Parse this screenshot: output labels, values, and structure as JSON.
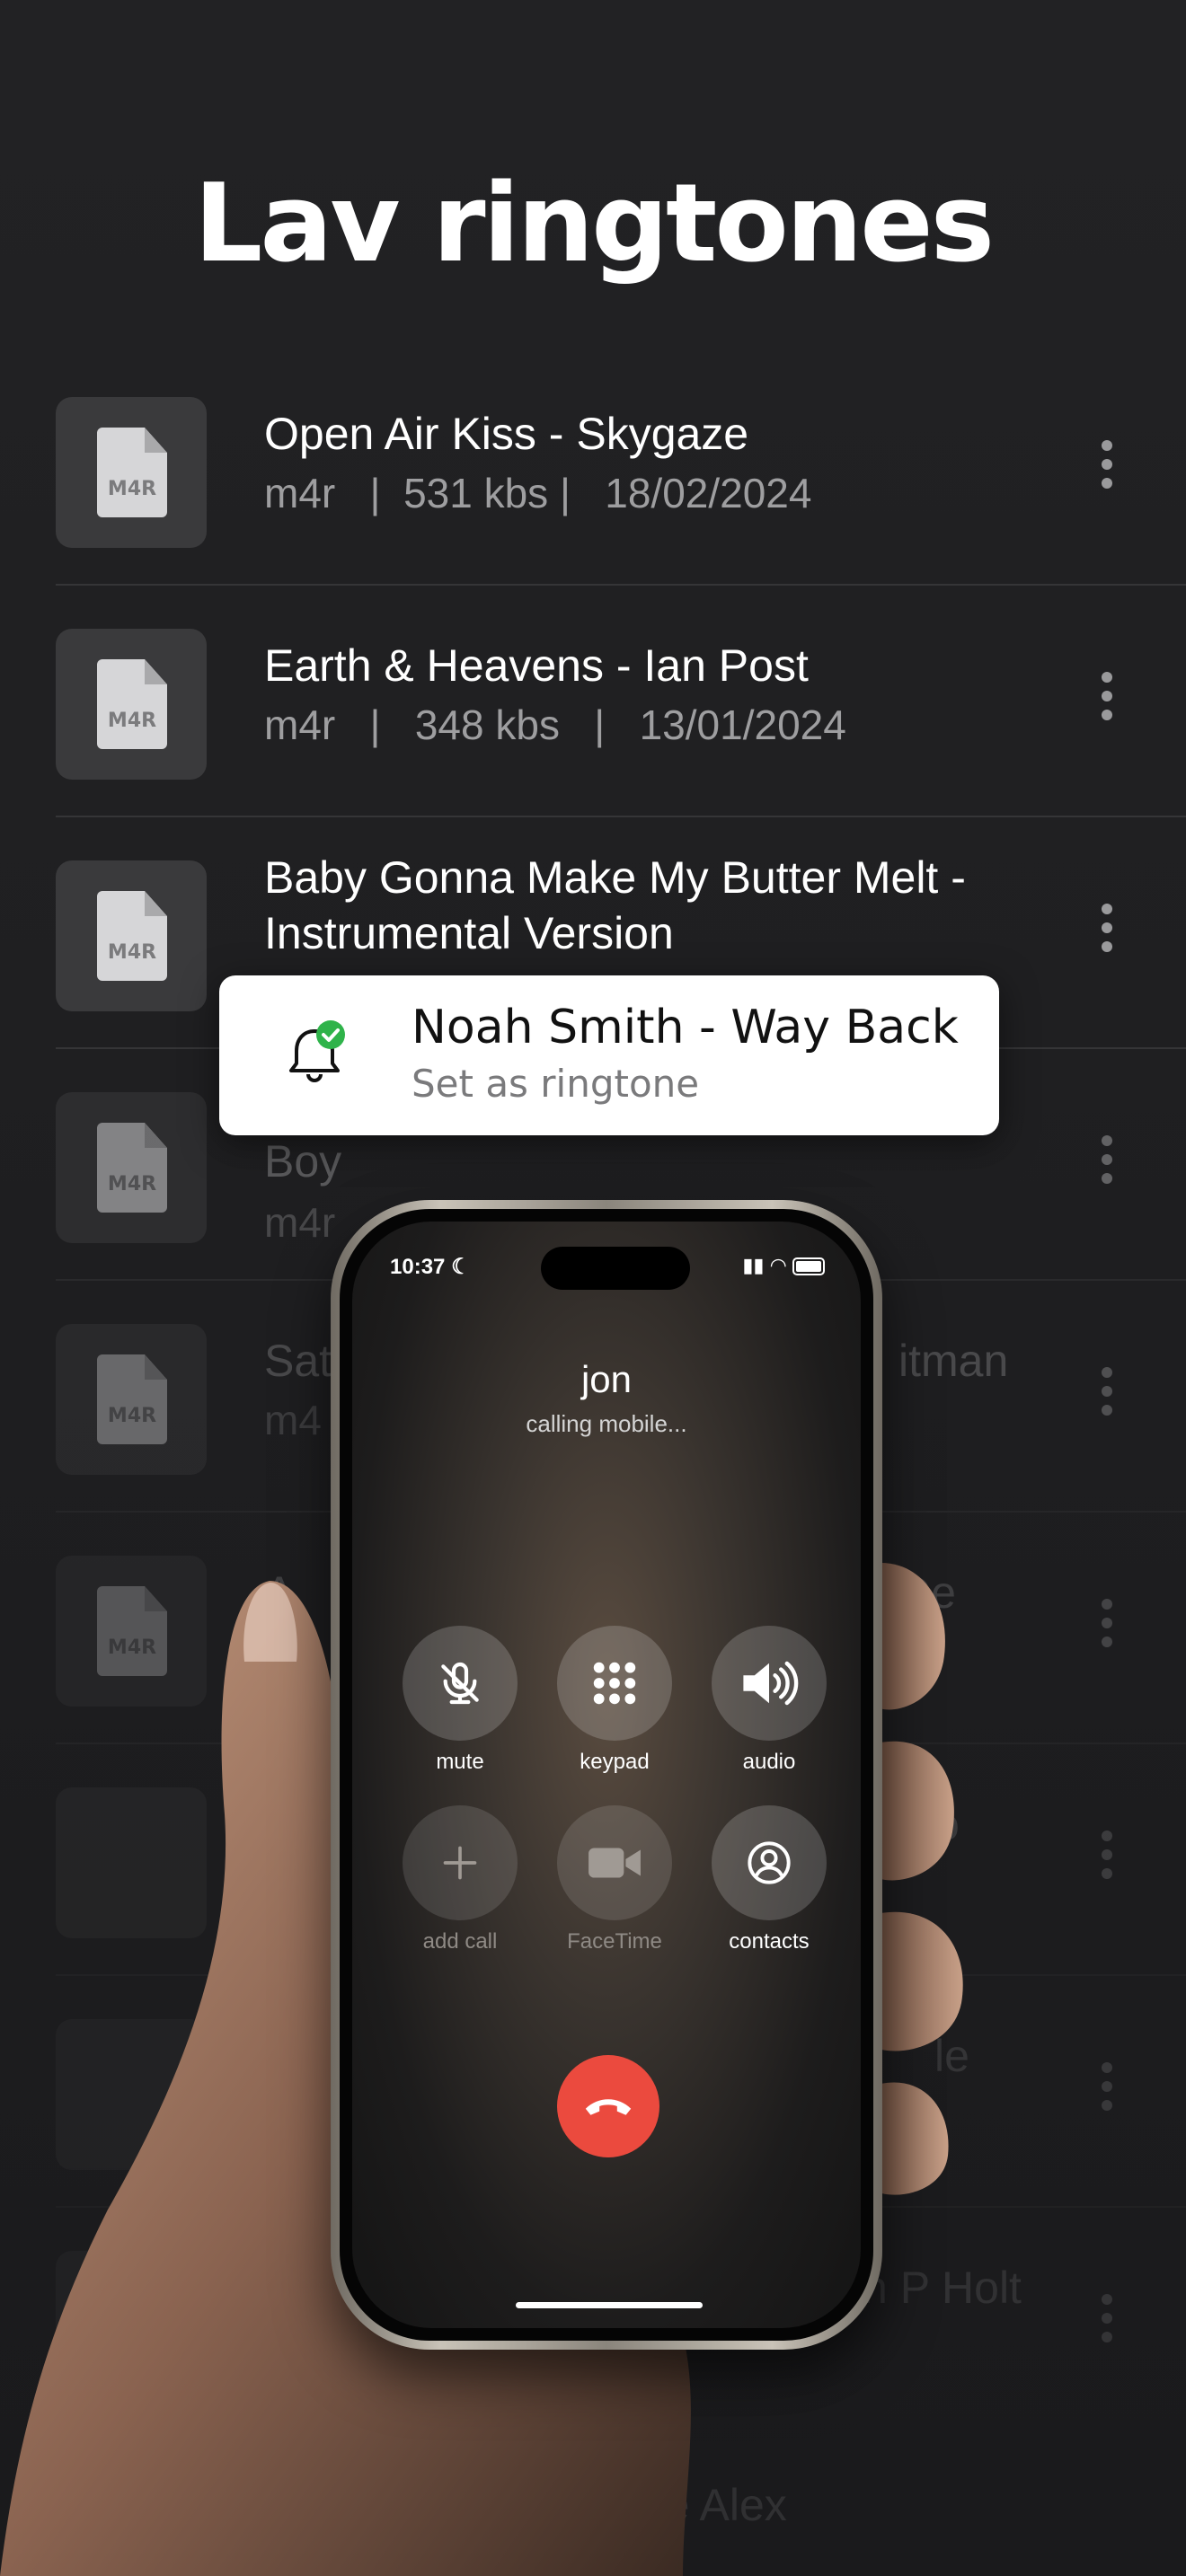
{
  "page_title": "Lav ringtones",
  "rows": [
    {
      "title": "Open Air Kiss - Skygaze",
      "meta": "m4r   |  531 kbs |   18/02/2024",
      "ext": "M4R"
    },
    {
      "title": "Earth & Heavens - Ian Post",
      "meta": "m4r   |   348 kbs   |   13/01/2024",
      "ext": "M4R"
    },
    {
      "title": "Baby Gonna Make My Butter Melt - Instrumental Version",
      "meta": "",
      "ext": "M4R"
    },
    {
      "title": "Boy",
      "meta": "m4r",
      "ext": "M4R"
    },
    {
      "title": "Sat",
      "meta": "m4",
      "ext": "M4R"
    },
    {
      "title": "A",
      "meta": "",
      "ext": "M4R"
    },
    {
      "title": "",
      "meta": "",
      "ext": "M4R"
    },
    {
      "title": "",
      "meta": "",
      "ext": ""
    },
    {
      "title": "",
      "meta": "",
      "ext": ""
    }
  ],
  "peek_text": {
    "r5": "itman",
    "r6": "De",
    "r7": "o",
    "r8": "le",
    "r9": "n P Holt",
    "r10": "The Jungle Alex"
  },
  "toast": {
    "title": "Noah Smith - Way Back",
    "subtitle": "Set as ringtone",
    "icon": "bell-check-icon"
  },
  "phone": {
    "status_time": "10:37",
    "caller": "jon",
    "status": "calling mobile...",
    "buttons": [
      {
        "label": "mute",
        "icon": "mic-off-icon",
        "enabled": true
      },
      {
        "label": "keypad",
        "icon": "keypad-icon",
        "enabled": true
      },
      {
        "label": "audio",
        "icon": "speaker-icon",
        "enabled": true
      },
      {
        "label": "add call",
        "icon": "plus-icon",
        "enabled": false
      },
      {
        "label": "FaceTime",
        "icon": "video-icon",
        "enabled": false
      },
      {
        "label": "contacts",
        "icon": "contact-icon",
        "enabled": true
      }
    ],
    "end_call_icon": "end-call-icon"
  },
  "colors": {
    "background": "#1f1f21",
    "end_call": "#eb4a3e",
    "badge_green": "#2fb34a"
  }
}
